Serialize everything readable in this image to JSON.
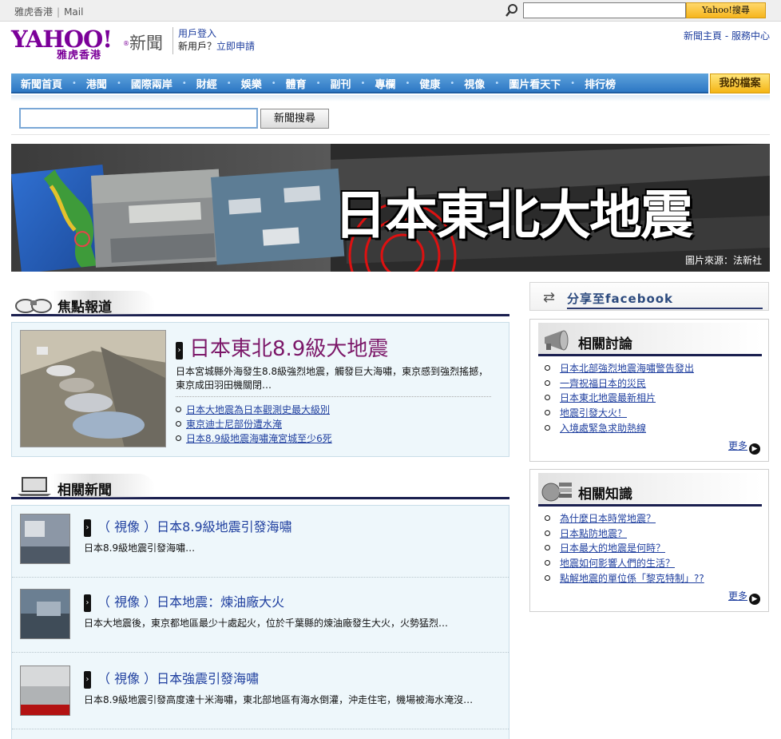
{
  "topbar": {
    "util_links": [
      "雅虎香港",
      "Mail"
    ],
    "search_value": "",
    "search_button": "Yahoo!搜尋"
  },
  "header": {
    "logo_text": "YAHOO!",
    "logo_sub": "雅虎香港",
    "section_name": "新聞",
    "login_link": "用戶登入",
    "new_user_prefix": "新用戶？",
    "register_link": "立即申請",
    "home_link": "新聞主頁",
    "link_sep": " - ",
    "service_link": "服務中心"
  },
  "nav": {
    "items": [
      "新聞首頁",
      "港聞",
      "國際兩岸",
      "財經",
      "娛樂",
      "體育",
      "副刊",
      "專欄",
      "健康",
      "視像",
      "圖片看天下",
      "排行榜"
    ],
    "my_page": "我的檔案"
  },
  "news_search": {
    "value": "",
    "button": "新聞搜尋"
  },
  "banner": {
    "title": "日本東北大地震",
    "credit": "圖片來源：法新社"
  },
  "focus": {
    "heading": "焦點報道",
    "headline": "日本東北8.9級大地震",
    "description": "日本宮城縣外海發生8.8級強烈地震，觸發巨大海嘯，東京感到強烈搖撼，東京成田羽田機關閉…",
    "links": [
      "日本大地震為日本觀測史最大級別",
      "東京迪士尼部份遭水淹",
      "日本8.9級地震海嘯淹宮城至少6死"
    ]
  },
  "related_news": {
    "heading": "相關新聞",
    "items": [
      {
        "title": "（ 視像 ）日本8.9級地震引發海嘯",
        "snippet": "日本8.9級地震引發海嘯…"
      },
      {
        "title": "（ 視像 ）日本地震：煉油廠大火",
        "snippet": "日本大地震後，東京都地區最少十處起火，位於千葉縣的煉油廠發生大火，火勢猛烈…"
      },
      {
        "title": "（ 視像 ）日本強震引發海嘯",
        "snippet": "日本8.9級地震引發高度達十米海嘯，東北部地區有海水倒灌，沖走住宅，機場被海水淹沒…"
      }
    ]
  },
  "sidebar": {
    "facebook_share": "分享至facebook",
    "discussion": {
      "heading": "相關討論",
      "links": [
        "日本北部強烈地震海嘯警告發出",
        "一齊祝福日本的災民",
        "日本東北地震最新相片",
        "地震引發大火！",
        "入境處緊急求助熱線"
      ],
      "more": "更多"
    },
    "knowledge": {
      "heading": "相關知識",
      "links": [
        "為什麼日本時常地震？",
        "日本點防地震？",
        "日本最大的地震是何時？",
        "地震如何影響人們的生活？",
        "點解地震的單位係「黎克特制」??"
      ],
      "more": "更多"
    }
  },
  "colors": {
    "brand_purple": "#7b0099",
    "nav_blue": "#2d77c4",
    "link_blue": "#1f3f9f",
    "headline_plum": "#7c1869",
    "box_bg": "#eef7fb"
  }
}
